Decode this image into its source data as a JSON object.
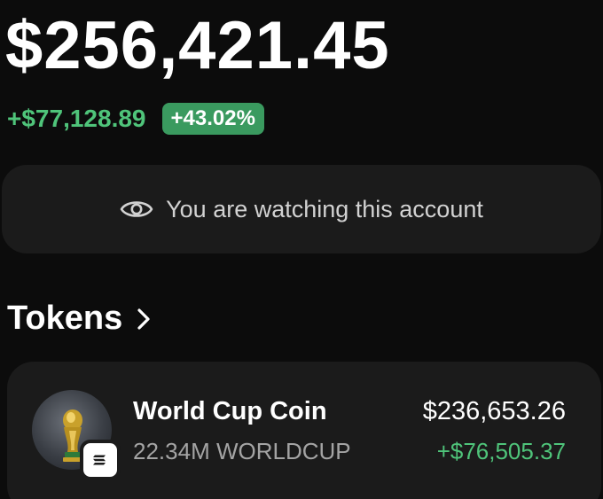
{
  "portfolio": {
    "balance": "$256,421.45",
    "change_amount": "+$77,128.89",
    "change_percent": "+43.02%"
  },
  "watch_banner": {
    "text": "You are watching this account",
    "icon": "eye-icon"
  },
  "tokens_section": {
    "title": "Tokens",
    "icon": "chevron-right-icon"
  },
  "tokens": [
    {
      "name": "World Cup Coin",
      "amount": "22.34M WORLDCUP",
      "value": "$236,653.26",
      "change": "+$76,505.37",
      "avatar_icon": "trophy-icon",
      "chain_icon": "solana-icon"
    }
  ],
  "colors": {
    "background": "#0c0c0c",
    "card": "#1b1b1b",
    "positive": "#4fc47a",
    "positive_pill": "#3a9a5f",
    "muted_text": "#a4a4a4"
  }
}
